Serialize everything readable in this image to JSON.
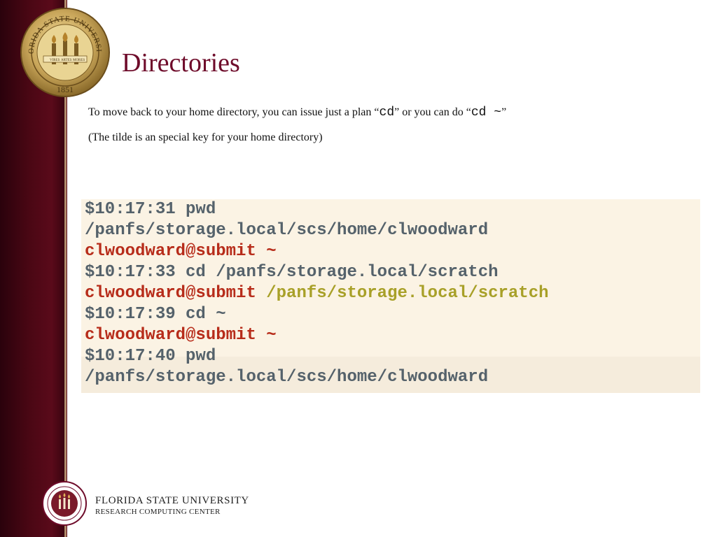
{
  "slide": {
    "title": "Directories",
    "line1_text": "To move back to your home directory, you can issue just a plan “",
    "line1_code1": "cd",
    "line1_mid": "” or you can do “",
    "line1_code2": "cd  ~",
    "line1_end": "”",
    "line2_text": "(The tilde is an special key for your home directory)"
  },
  "terminal": {
    "l1_prompt": "$10:17:31",
    "l1_cmd": " pwd",
    "l2": "/panfs/storage.local/scs/home/clwoodward",
    "l3_user": "clwoodward@submit",
    "l3_path": " ~",
    "l4_prompt": "$10:17:33",
    "l4_cmd": " cd /panfs/storage.local/scratch",
    "l5_user": "clwoodward@submit",
    "l5_path": " /panfs/storage.local/scratch",
    "l6_prompt": "$10:17:39",
    "l6_cmd": " cd ~",
    "l7_user": "clwoodward@submit",
    "l7_path": " ~",
    "l8_prompt": "$10:17:40",
    "l8_cmd": " pwd",
    "l9": "/panfs/storage.local/scs/home/clwoodward"
  },
  "seal": {
    "ring_text": "FLORIDA STATE UNIVERSITY",
    "year": "1851",
    "banner_left": "VIRES",
    "banner_mid": "ARTES",
    "banner_right": "MORES"
  },
  "footer": {
    "university": "FLORIDA STATE UNIVERSITY",
    "center": "RESEARCH COMPUTING CENTER"
  },
  "colors": {
    "sidebar": "#4a0714",
    "title": "#6e0b2a",
    "terminal_bg": "#fbf3e4",
    "prompt_gray": "#55626b",
    "user_red": "#b72c1a",
    "path_olive": "#a8a028"
  }
}
